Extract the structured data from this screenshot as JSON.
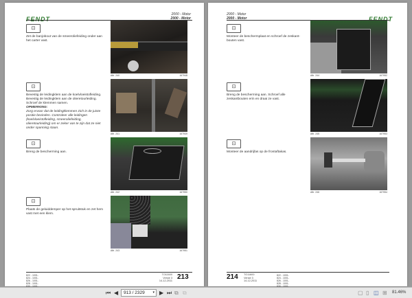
{
  "left_page": {
    "logo": "FENDT",
    "header_line1": "2000 - Motor",
    "header_line2": "2000 - Motor",
    "steps": [
      {
        "text": "Zet de banjobout van de smeeroliefeiding onder aan het carter vast.",
        "caption": "Afb. 240",
        "code": "167948"
      },
      {
        "text": "Bevestig de leidingklem aan de koelvloeistofleiding. Bevestig de leidingklem aan de olieretourleiding. Schroef de klemmen samen.",
        "note_title": "OPMERKING:",
        "note": "Zorg ervoor dat de leidingklemmen zich in de juiste positie bevinden. Controleer alle leidingen (koelvloeistofleiding, smeeroliefeiding, olieretourleiding) om er zeker van te zijn dat ze niet onder spanning staan.",
        "caption": "Afb. 241",
        "code": "167949"
      },
      {
        "text": "Breng de bescherming aan.",
        "caption": "Afb. 242",
        "code": "167950"
      },
      {
        "text": "Plaats de geluiddemper op het spruitstuk en zet hem vast met een klem.",
        "caption": "Afb. 243",
        "code": "167951"
      }
    ],
    "footer_codes": [
      "822 - 1001-",
      "824 - 1001-",
      "826 - 1001-",
      "828 - 1001-",
      "830 - 1001-"
    ],
    "footer_doc": "TO11600",
    "footer_version": "Versie 3",
    "footer_date": "14-12-2011",
    "page_number": "213"
  },
  "right_page": {
    "logo": "FENDT",
    "header_line1": "2000 - Motor",
    "header_line2": "2000 - Motor",
    "steps": [
      {
        "text": "Monteer de beschermplaat en schroef de zeskant-bouten vast.",
        "caption": "Afb. 244",
        "code": "167952"
      },
      {
        "text": "Breng de bescherming aan. Schroef alle zeskantbouten erin en draai ze vast.",
        "caption": "Afb. 245",
        "code": "167953"
      },
      {
        "text": "Monteer de aandrijfas op de frontaftakas.",
        "caption": "Afb. 246",
        "code": "167954"
      }
    ],
    "footer_codes": [
      "822 - 1001-",
      "824 - 1001-",
      "826 - 1001-",
      "828 - 1001-",
      "830 - 1001-"
    ],
    "footer_doc": "TO11600",
    "footer_version": "Versie 3",
    "footer_date": "14-12-2011",
    "page_number": "214"
  },
  "toolbar": {
    "page_indicator": "913 / 2329",
    "zoom_level": "81.46%"
  },
  "colors": {
    "brand": "#2f7a2f",
    "background": "#9b9b9b"
  }
}
